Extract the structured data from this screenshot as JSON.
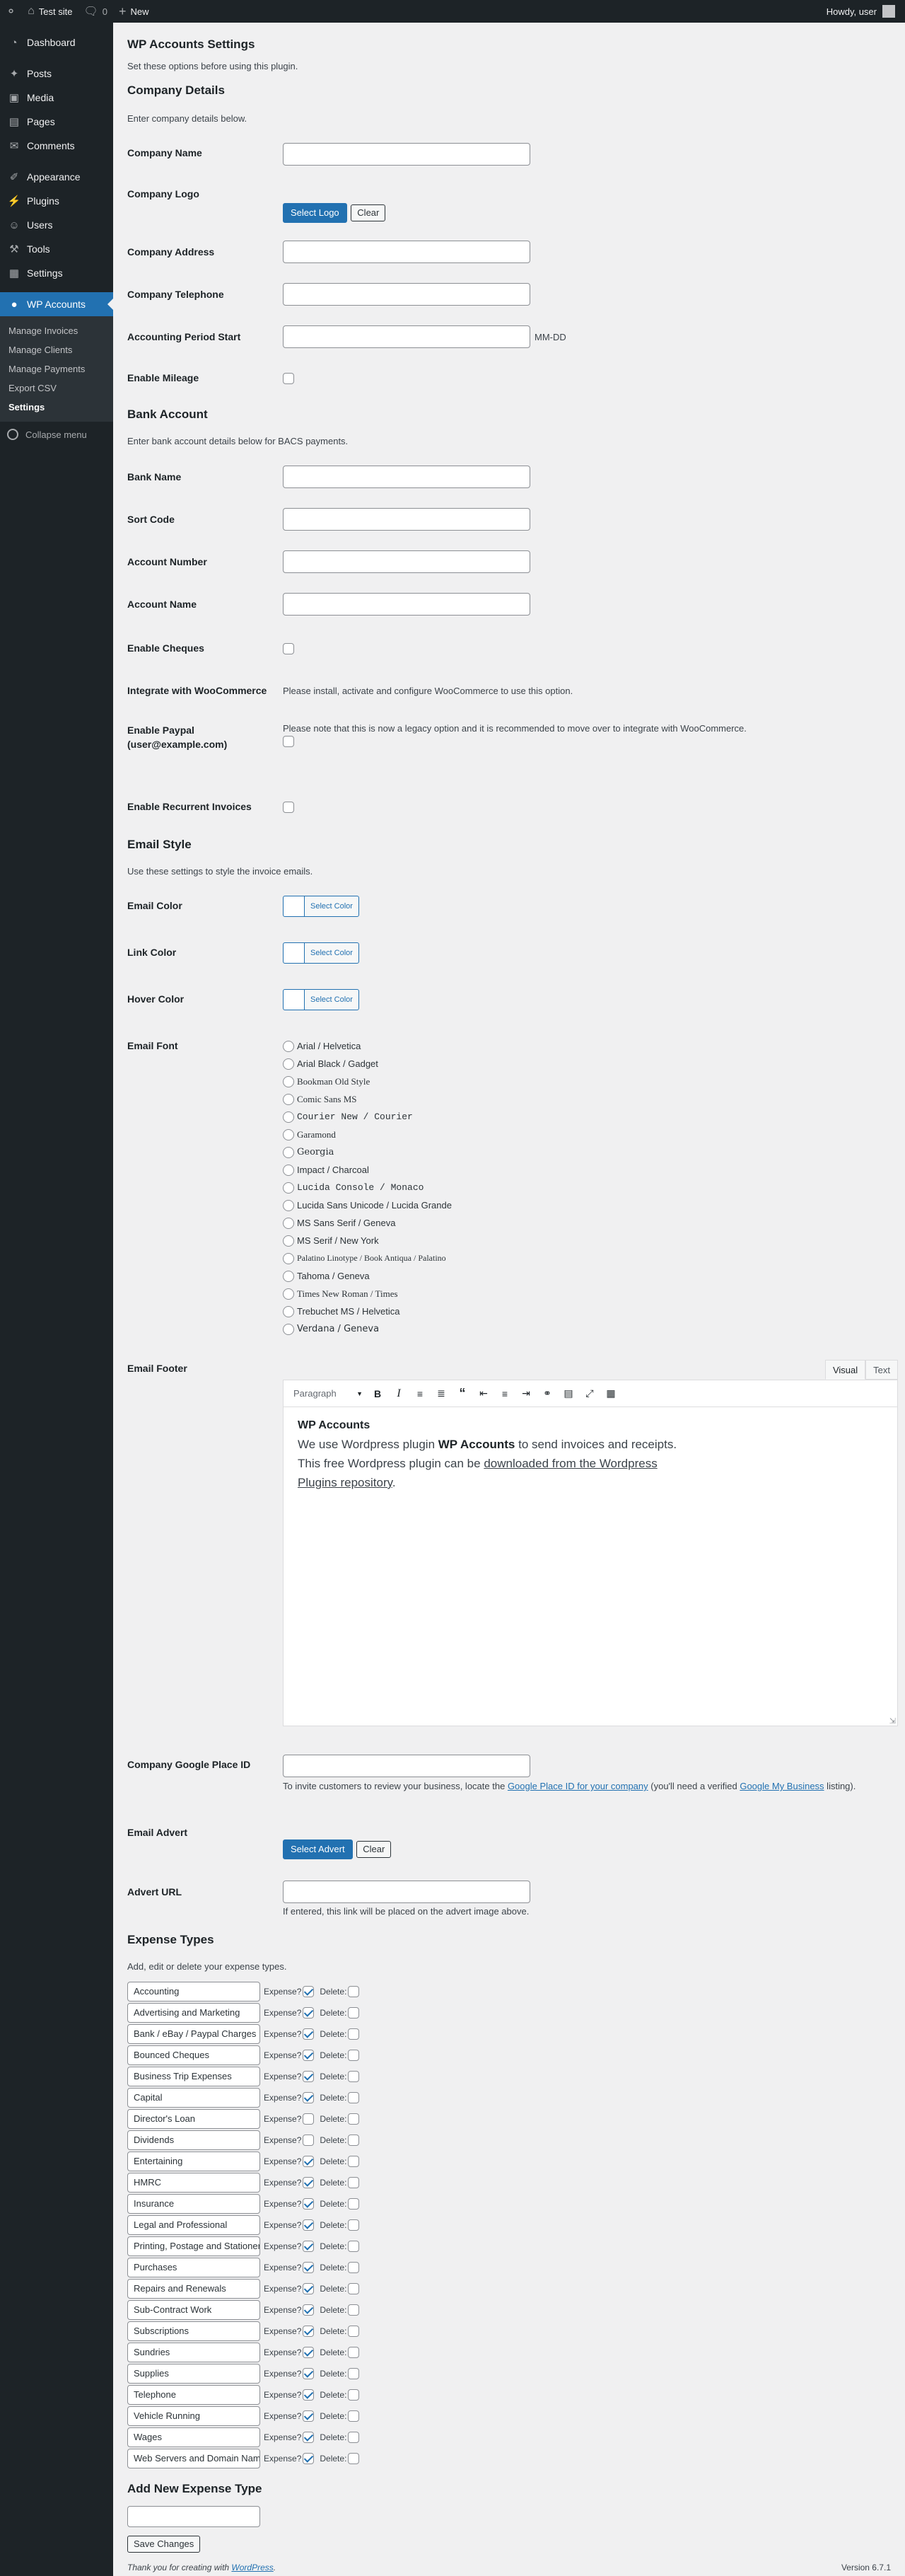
{
  "adminbar": {
    "site_name": "Test site",
    "comments_count": "0",
    "new_label": "New",
    "howdy": "Howdy, user"
  },
  "sidebar": {
    "items": [
      {
        "label": "Dashboard",
        "icon": "dashboard-icon"
      },
      {
        "label": "Posts",
        "icon": "pin-icon"
      },
      {
        "label": "Media",
        "icon": "media-icon"
      },
      {
        "label": "Pages",
        "icon": "pages-icon"
      },
      {
        "label": "Comments",
        "icon": "comment-icon"
      },
      {
        "label": "Appearance",
        "icon": "brush-icon"
      },
      {
        "label": "Plugins",
        "icon": "plug-icon"
      },
      {
        "label": "Users",
        "icon": "user-icon"
      },
      {
        "label": "Tools",
        "icon": "wrench-icon"
      },
      {
        "label": "Settings",
        "icon": "settings-icon"
      },
      {
        "label": "WP Accounts",
        "icon": "coins-icon"
      }
    ],
    "submenu": [
      "Manage Invoices",
      "Manage Clients",
      "Manage Payments",
      "Export CSV",
      "Settings"
    ],
    "collapse": "Collapse menu"
  },
  "page": {
    "title": "WP Accounts Settings",
    "intro": "Set these options before using this plugin."
  },
  "company": {
    "heading": "Company Details",
    "desc": "Enter company details below.",
    "name_label": "Company Name",
    "logo_label": "Company Logo",
    "select_logo": "Select Logo",
    "clear": "Clear",
    "address_label": "Company Address",
    "telephone_label": "Company Telephone",
    "period_label": "Accounting Period Start",
    "period_hint": "MM-DD",
    "mileage_label": "Enable Mileage"
  },
  "bank": {
    "heading": "Bank Account",
    "desc": "Enter bank account details below for BACS payments.",
    "bank_name": "Bank Name",
    "sort_code": "Sort Code",
    "account_number": "Account Number",
    "account_name": "Account Name",
    "cheques": "Enable Cheques",
    "woo_label": "Integrate with WooCommerce",
    "woo_text": "Please install, activate and configure WooCommerce to use this option.",
    "paypal_label": "Enable Paypal (user@example.com)",
    "paypal_text": "Please note that this is now a legacy option and it is recommended to move over to integrate with WooCommerce.",
    "recurrent": "Enable Recurrent Invoices"
  },
  "email_style": {
    "heading": "Email Style",
    "desc": "Use these settings to style the invoice emails.",
    "email_color": "Email Color",
    "link_color": "Link Color",
    "hover_color": "Hover Color",
    "select_color": "Select Color",
    "font_label": "Email Font",
    "fonts": [
      "Arial / Helvetica",
      "Arial Black / Gadget",
      "Bookman Old Style",
      "Comic Sans MS",
      "Courier New / Courier",
      "Garamond",
      "Georgia",
      "Impact / Charcoal",
      "Lucida Console / Monaco",
      "Lucida Sans Unicode / Lucida Grande",
      "MS Sans Serif / Geneva",
      "MS Serif / New York",
      "Palatino Linotype / Book Antiqua / Palatino",
      "Tahoma / Geneva",
      "Times New Roman / Times",
      "Trebuchet MS / Helvetica",
      "Verdana / Geneva"
    ],
    "footer_label": "Email Footer",
    "tab_visual": "Visual",
    "tab_text": "Text",
    "paragraph": "Paragraph",
    "footer_heading": "WP Accounts",
    "footer_p1": "We use Wordpress plugin ",
    "footer_strong": "WP Accounts",
    "footer_p2": " to send invoices and receipts. This free Wordpress plugin can be ",
    "footer_link": "downloaded from the Wordpress Plugins repository",
    "footer_end": "."
  },
  "google": {
    "label": "Company Google Place ID",
    "help1": "To invite customers to review your business, locate the ",
    "help_link1": "Google Place ID for your company",
    "help2": " (you'll need a verified ",
    "help_link2": "Google My Business",
    "help3": " listing)."
  },
  "advert": {
    "label": "Email Advert",
    "select": "Select Advert",
    "clear": "Clear",
    "url_label": "Advert URL",
    "url_help": "If entered, this link will be placed on the advert image above."
  },
  "expense": {
    "heading": "Expense Types",
    "desc": "Add, edit or delete your expense types.",
    "expense_lbl": "Expense?",
    "delete_lbl": "Delete:",
    "items": [
      {
        "name": "Accounting",
        "expense": true
      },
      {
        "name": "Advertising and Marketing",
        "expense": true
      },
      {
        "name": "Bank / eBay / Paypal Charges",
        "expense": true
      },
      {
        "name": "Bounced Cheques",
        "expense": true
      },
      {
        "name": "Business Trip Expenses",
        "expense": true
      },
      {
        "name": "Capital",
        "expense": true
      },
      {
        "name": "Director's Loan",
        "expense": false
      },
      {
        "name": "Dividends",
        "expense": false
      },
      {
        "name": "Entertaining",
        "expense": true
      },
      {
        "name": "HMRC",
        "expense": true
      },
      {
        "name": "Insurance",
        "expense": true
      },
      {
        "name": "Legal and Professional",
        "expense": true
      },
      {
        "name": "Printing, Postage and Stationery",
        "expense": true
      },
      {
        "name": "Purchases",
        "expense": true
      },
      {
        "name": "Repairs and Renewals",
        "expense": true
      },
      {
        "name": "Sub-Contract Work",
        "expense": true
      },
      {
        "name": "Subscriptions",
        "expense": true
      },
      {
        "name": "Sundries",
        "expense": true
      },
      {
        "name": "Supplies",
        "expense": true
      },
      {
        "name": "Telephone",
        "expense": true
      },
      {
        "name": "Vehicle Running",
        "expense": true
      },
      {
        "name": "Wages",
        "expense": true
      },
      {
        "name": "Web Servers and Domain Names",
        "expense": true
      }
    ],
    "add_heading": "Add New Expense Type",
    "save": "Save Changes"
  },
  "footer": {
    "thanks": "Thank you for creating with ",
    "wp_link": "WordPress",
    "thanks_end": ".",
    "version": "Version 6.7.1"
  },
  "colors": {
    "accent": "#2271b1",
    "sidebar": "#1d2327",
    "background": "#f0f0f1"
  }
}
